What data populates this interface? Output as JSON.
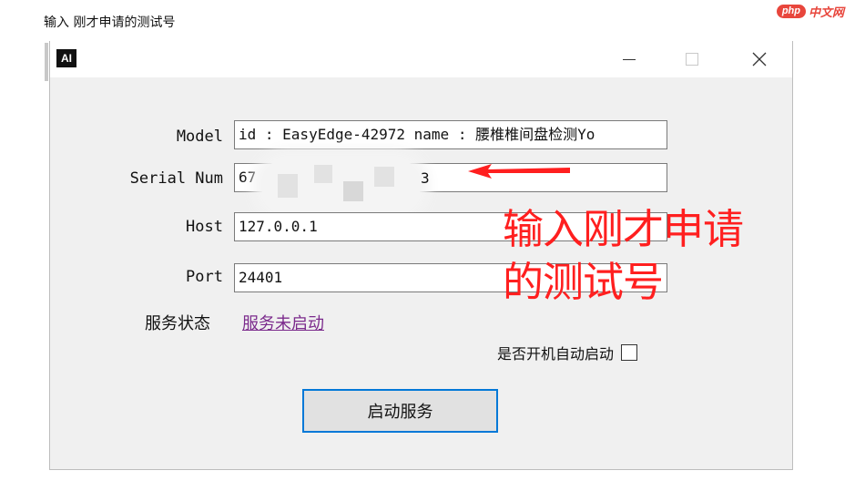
{
  "caption": "输入 刚才申请的测试号",
  "watermark": {
    "pill": "php",
    "text": "中文网"
  },
  "window": {
    "icon_text": "AI",
    "controls": {
      "minimize": "minimize-icon",
      "maximize": "maximize-icon",
      "close": "close-icon"
    }
  },
  "form": {
    "model": {
      "label": "Model",
      "value": "id : EasyEdge-42972 name : 腰椎椎间盘检测Yo"
    },
    "serial": {
      "label": "Serial Num",
      "value": "67",
      "value_tail": "3"
    },
    "host": {
      "label": "Host",
      "value": "127.0.0.1"
    },
    "port": {
      "label": "Port",
      "value": "24401"
    }
  },
  "status": {
    "label": "服务状态",
    "link": "服务未启动"
  },
  "autostart": {
    "label": "是否开机自动启动",
    "checked": false
  },
  "start_button": "启动服务",
  "annotation": {
    "line1": "输入刚才申请",
    "line2": "的测试号",
    "color": "#ff1f1f"
  }
}
